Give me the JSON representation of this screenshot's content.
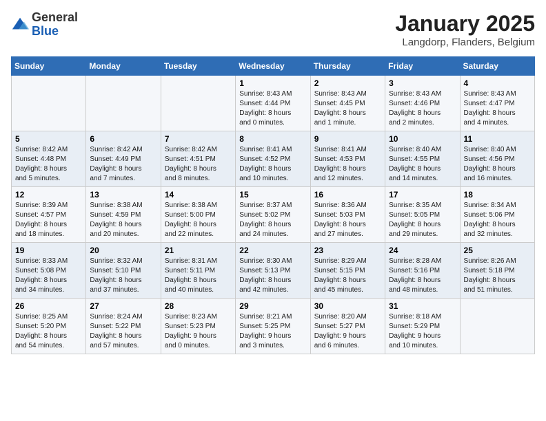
{
  "logo": {
    "general": "General",
    "blue": "Blue"
  },
  "title": "January 2025",
  "subtitle": "Langdorp, Flanders, Belgium",
  "weekdays": [
    "Sunday",
    "Monday",
    "Tuesday",
    "Wednesday",
    "Thursday",
    "Friday",
    "Saturday"
  ],
  "weeks": [
    [
      {
        "day": "",
        "content": ""
      },
      {
        "day": "",
        "content": ""
      },
      {
        "day": "",
        "content": ""
      },
      {
        "day": "1",
        "content": "Sunrise: 8:43 AM\nSunset: 4:44 PM\nDaylight: 8 hours\nand 0 minutes."
      },
      {
        "day": "2",
        "content": "Sunrise: 8:43 AM\nSunset: 4:45 PM\nDaylight: 8 hours\nand 1 minute."
      },
      {
        "day": "3",
        "content": "Sunrise: 8:43 AM\nSunset: 4:46 PM\nDaylight: 8 hours\nand 2 minutes."
      },
      {
        "day": "4",
        "content": "Sunrise: 8:43 AM\nSunset: 4:47 PM\nDaylight: 8 hours\nand 4 minutes."
      }
    ],
    [
      {
        "day": "5",
        "content": "Sunrise: 8:42 AM\nSunset: 4:48 PM\nDaylight: 8 hours\nand 5 minutes."
      },
      {
        "day": "6",
        "content": "Sunrise: 8:42 AM\nSunset: 4:49 PM\nDaylight: 8 hours\nand 7 minutes."
      },
      {
        "day": "7",
        "content": "Sunrise: 8:42 AM\nSunset: 4:51 PM\nDaylight: 8 hours\nand 8 minutes."
      },
      {
        "day": "8",
        "content": "Sunrise: 8:41 AM\nSunset: 4:52 PM\nDaylight: 8 hours\nand 10 minutes."
      },
      {
        "day": "9",
        "content": "Sunrise: 8:41 AM\nSunset: 4:53 PM\nDaylight: 8 hours\nand 12 minutes."
      },
      {
        "day": "10",
        "content": "Sunrise: 8:40 AM\nSunset: 4:55 PM\nDaylight: 8 hours\nand 14 minutes."
      },
      {
        "day": "11",
        "content": "Sunrise: 8:40 AM\nSunset: 4:56 PM\nDaylight: 8 hours\nand 16 minutes."
      }
    ],
    [
      {
        "day": "12",
        "content": "Sunrise: 8:39 AM\nSunset: 4:57 PM\nDaylight: 8 hours\nand 18 minutes."
      },
      {
        "day": "13",
        "content": "Sunrise: 8:38 AM\nSunset: 4:59 PM\nDaylight: 8 hours\nand 20 minutes."
      },
      {
        "day": "14",
        "content": "Sunrise: 8:38 AM\nSunset: 5:00 PM\nDaylight: 8 hours\nand 22 minutes."
      },
      {
        "day": "15",
        "content": "Sunrise: 8:37 AM\nSunset: 5:02 PM\nDaylight: 8 hours\nand 24 minutes."
      },
      {
        "day": "16",
        "content": "Sunrise: 8:36 AM\nSunset: 5:03 PM\nDaylight: 8 hours\nand 27 minutes."
      },
      {
        "day": "17",
        "content": "Sunrise: 8:35 AM\nSunset: 5:05 PM\nDaylight: 8 hours\nand 29 minutes."
      },
      {
        "day": "18",
        "content": "Sunrise: 8:34 AM\nSunset: 5:06 PM\nDaylight: 8 hours\nand 32 minutes."
      }
    ],
    [
      {
        "day": "19",
        "content": "Sunrise: 8:33 AM\nSunset: 5:08 PM\nDaylight: 8 hours\nand 34 minutes."
      },
      {
        "day": "20",
        "content": "Sunrise: 8:32 AM\nSunset: 5:10 PM\nDaylight: 8 hours\nand 37 minutes."
      },
      {
        "day": "21",
        "content": "Sunrise: 8:31 AM\nSunset: 5:11 PM\nDaylight: 8 hours\nand 40 minutes."
      },
      {
        "day": "22",
        "content": "Sunrise: 8:30 AM\nSunset: 5:13 PM\nDaylight: 8 hours\nand 42 minutes."
      },
      {
        "day": "23",
        "content": "Sunrise: 8:29 AM\nSunset: 5:15 PM\nDaylight: 8 hours\nand 45 minutes."
      },
      {
        "day": "24",
        "content": "Sunrise: 8:28 AM\nSunset: 5:16 PM\nDaylight: 8 hours\nand 48 minutes."
      },
      {
        "day": "25",
        "content": "Sunrise: 8:26 AM\nSunset: 5:18 PM\nDaylight: 8 hours\nand 51 minutes."
      }
    ],
    [
      {
        "day": "26",
        "content": "Sunrise: 8:25 AM\nSunset: 5:20 PM\nDaylight: 8 hours\nand 54 minutes."
      },
      {
        "day": "27",
        "content": "Sunrise: 8:24 AM\nSunset: 5:22 PM\nDaylight: 8 hours\nand 57 minutes."
      },
      {
        "day": "28",
        "content": "Sunrise: 8:23 AM\nSunset: 5:23 PM\nDaylight: 9 hours\nand 0 minutes."
      },
      {
        "day": "29",
        "content": "Sunrise: 8:21 AM\nSunset: 5:25 PM\nDaylight: 9 hours\nand 3 minutes."
      },
      {
        "day": "30",
        "content": "Sunrise: 8:20 AM\nSunset: 5:27 PM\nDaylight: 9 hours\nand 6 minutes."
      },
      {
        "day": "31",
        "content": "Sunrise: 8:18 AM\nSunset: 5:29 PM\nDaylight: 9 hours\nand 10 minutes."
      },
      {
        "day": "",
        "content": ""
      }
    ]
  ]
}
